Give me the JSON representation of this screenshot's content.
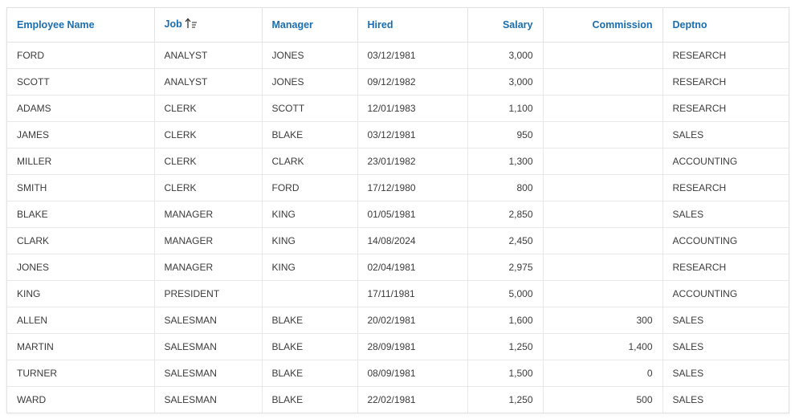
{
  "columns": [
    {
      "key": "ename",
      "label": "Employee Name",
      "align": "left"
    },
    {
      "key": "job",
      "label": "Job",
      "align": "left",
      "sort": "ascending"
    },
    {
      "key": "mgr",
      "label": "Manager",
      "align": "left"
    },
    {
      "key": "hired",
      "label": "Hired",
      "align": "left"
    },
    {
      "key": "sal",
      "label": "Salary",
      "align": "right"
    },
    {
      "key": "comm",
      "label": "Commission",
      "align": "right"
    },
    {
      "key": "deptno",
      "label": "Deptno",
      "align": "left"
    }
  ],
  "rows": [
    {
      "ename": "FORD",
      "job": "ANALYST",
      "mgr": "JONES",
      "hired": "03/12/1981",
      "sal": "3,000",
      "comm": "",
      "deptno": "RESEARCH"
    },
    {
      "ename": "SCOTT",
      "job": "ANALYST",
      "mgr": "JONES",
      "hired": "09/12/1982",
      "sal": "3,000",
      "comm": "",
      "deptno": "RESEARCH"
    },
    {
      "ename": "ADAMS",
      "job": "CLERK",
      "mgr": "SCOTT",
      "hired": "12/01/1983",
      "sal": "1,100",
      "comm": "",
      "deptno": "RESEARCH"
    },
    {
      "ename": "JAMES",
      "job": "CLERK",
      "mgr": "BLAKE",
      "hired": "03/12/1981",
      "sal": "950",
      "comm": "",
      "deptno": "SALES"
    },
    {
      "ename": "MILLER",
      "job": "CLERK",
      "mgr": "CLARK",
      "hired": "23/01/1982",
      "sal": "1,300",
      "comm": "",
      "deptno": "ACCOUNTING"
    },
    {
      "ename": "SMITH",
      "job": "CLERK",
      "mgr": "FORD",
      "hired": "17/12/1980",
      "sal": "800",
      "comm": "",
      "deptno": "RESEARCH"
    },
    {
      "ename": "BLAKE",
      "job": "MANAGER",
      "mgr": "KING",
      "hired": "01/05/1981",
      "sal": "2,850",
      "comm": "",
      "deptno": "SALES"
    },
    {
      "ename": "CLARK",
      "job": "MANAGER",
      "mgr": "KING",
      "hired": "14/08/2024",
      "sal": "2,450",
      "comm": "",
      "deptno": "ACCOUNTING"
    },
    {
      "ename": "JONES",
      "job": "MANAGER",
      "mgr": "KING",
      "hired": "02/04/1981",
      "sal": "2,975",
      "comm": "",
      "deptno": "RESEARCH"
    },
    {
      "ename": "KING",
      "job": "PRESIDENT",
      "mgr": "",
      "hired": "17/11/1981",
      "sal": "5,000",
      "comm": "",
      "deptno": "ACCOUNTING"
    },
    {
      "ename": "ALLEN",
      "job": "SALESMAN",
      "mgr": "BLAKE",
      "hired": "20/02/1981",
      "sal": "1,600",
      "comm": "300",
      "deptno": "SALES"
    },
    {
      "ename": "MARTIN",
      "job": "SALESMAN",
      "mgr": "BLAKE",
      "hired": "28/09/1981",
      "sal": "1,250",
      "comm": "1,400",
      "deptno": "SALES"
    },
    {
      "ename": "TURNER",
      "job": "SALESMAN",
      "mgr": "BLAKE",
      "hired": "08/09/1981",
      "sal": "1,500",
      "comm": "0",
      "deptno": "SALES"
    },
    {
      "ename": "WARD",
      "job": "SALESMAN",
      "mgr": "BLAKE",
      "hired": "22/02/1981",
      "sal": "1,250",
      "comm": "500",
      "deptno": "SALES"
    }
  ],
  "icons": {
    "sort": "sort-ascending-icon"
  },
  "colors": {
    "header_text": "#1a6eb0",
    "cell_text": "#3b3b3b",
    "border": "#e8e8e8"
  }
}
